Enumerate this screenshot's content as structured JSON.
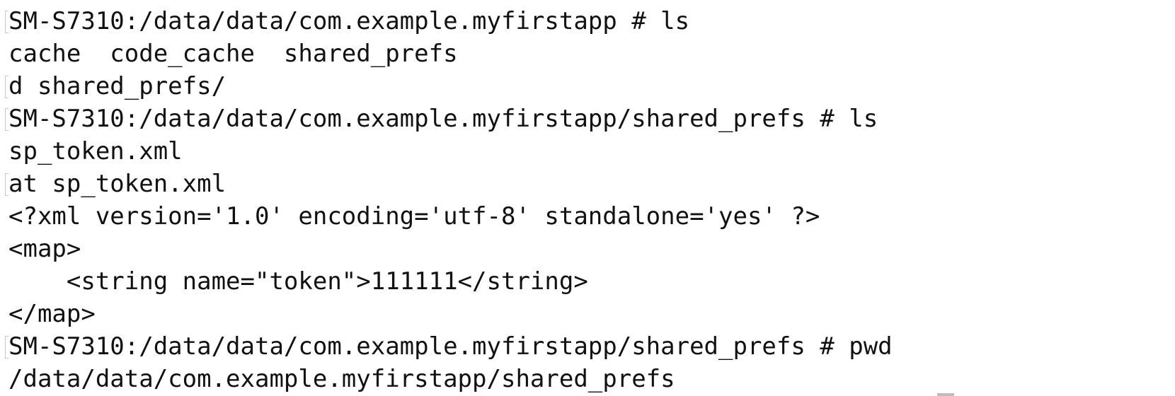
{
  "terminal": {
    "lines": [
      {
        "text": "SM-S7310:/data/data/com.example.myfirstapp # ls",
        "type": "prompt"
      },
      {
        "text": "cache  code_cache  shared_prefs",
        "type": "output"
      },
      {
        "text": "d shared_prefs/",
        "type": "echo"
      },
      {
        "text": "SM-S7310:/data/data/com.example.myfirstapp/shared_prefs # ls",
        "type": "prompt"
      },
      {
        "text": "sp_token.xml",
        "type": "output"
      },
      {
        "text": "at sp_token.xml",
        "type": "echo"
      },
      {
        "text": "<?xml version='1.0' encoding='utf-8' standalone='yes' ?>",
        "type": "output"
      },
      {
        "text": "<map>",
        "type": "output"
      },
      {
        "text": "    <string name=\"token\">111111</string>",
        "type": "output"
      },
      {
        "text": "</map>",
        "type": "output"
      },
      {
        "text": "SM-S7310:/data/data/com.example.myfirstapp/shared_prefs # pwd",
        "type": "prompt"
      },
      {
        "text": "/data/data/com.example.myfirstapp/shared_prefs",
        "type": "output"
      }
    ]
  }
}
